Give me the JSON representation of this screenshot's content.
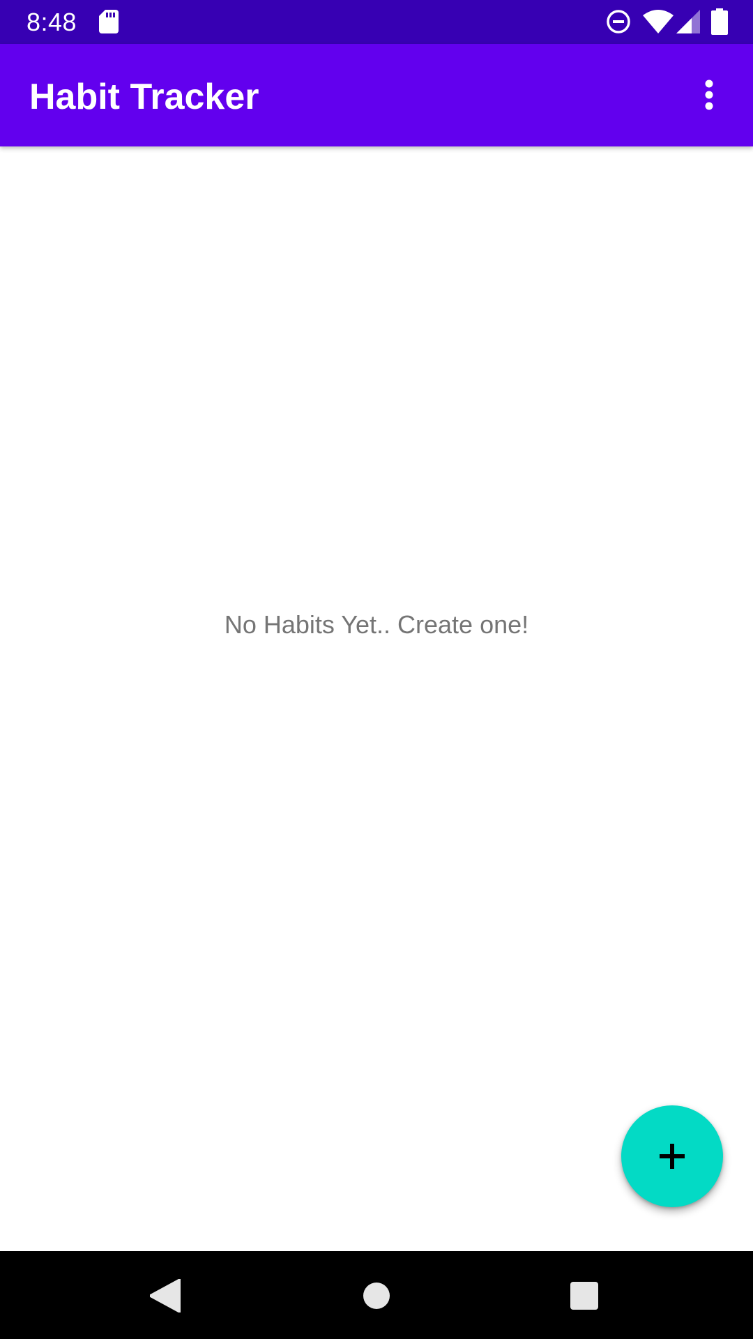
{
  "status_bar": {
    "time": "8:48",
    "icons": [
      "sd-card-icon",
      "do-not-disturb-icon",
      "wifi-icon",
      "cell-signal-icon",
      "battery-icon"
    ]
  },
  "app_bar": {
    "title": "Habit Tracker",
    "overflow_icon": "more-vert-icon"
  },
  "main": {
    "empty_message": "No Habits Yet.. Create one!"
  },
  "fab": {
    "icon": "plus-icon"
  },
  "nav_bar": {
    "icons": [
      "back-icon",
      "home-icon",
      "recents-icon"
    ]
  },
  "colors": {
    "status_bar": "#3700B3",
    "primary": "#6200EE",
    "accent": "#03DAC5",
    "empty_text": "#757575",
    "nav_bar": "#000000"
  }
}
